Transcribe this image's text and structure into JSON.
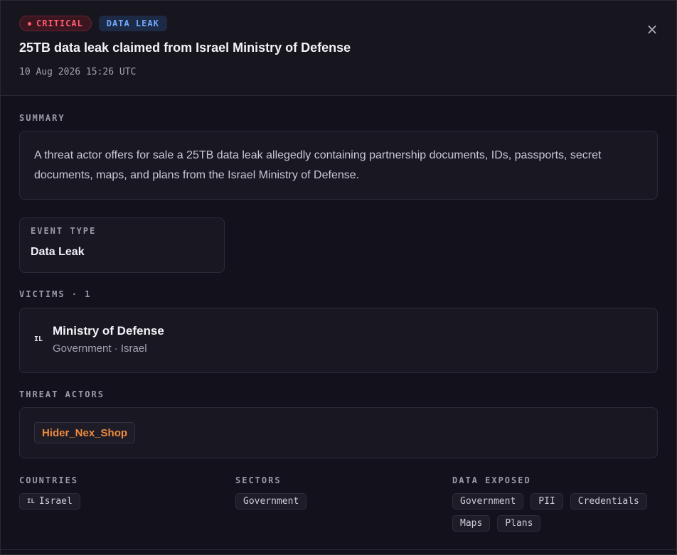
{
  "header": {
    "severity_badge": "CRITICAL",
    "type_badge": "DATA LEAK",
    "title": "25TB data leak claimed from Israel Ministry of Defense",
    "timestamp": "10 Aug 2026 15:26 UTC",
    "close_label": "×"
  },
  "summary": {
    "label": "SUMMARY",
    "text": "A threat actor offers for sale a 25TB data leak allegedly containing partnership documents, IDs, passports, secret documents, maps, and plans from the Israel Ministry of Defense."
  },
  "event": {
    "label": "EVENT TYPE",
    "value": "Data Leak"
  },
  "victims": {
    "label": "VICTIMS · 1",
    "items": [
      {
        "flag": "IL",
        "name": "Ministry of Defense",
        "meta": "Government · Israel"
      }
    ]
  },
  "threat_actors": {
    "label": "THREAT ACTORS",
    "items": [
      "Hider_Nex_Shop"
    ]
  },
  "countries": {
    "label": "COUNTRIES",
    "items": [
      {
        "code": "IL",
        "name": "Israel"
      }
    ]
  },
  "sectors": {
    "label": "SECTORS",
    "items": [
      "Government"
    ]
  },
  "data_exposed": {
    "label": "DATA EXPOSED",
    "items": [
      "Government",
      "PII",
      "Credentials",
      "Maps",
      "Plans"
    ]
  },
  "colors": {
    "critical": "#ff5c6f",
    "data_leak": "#6ea8ff",
    "actor": "#f08a3c",
    "background": "#13121c"
  }
}
